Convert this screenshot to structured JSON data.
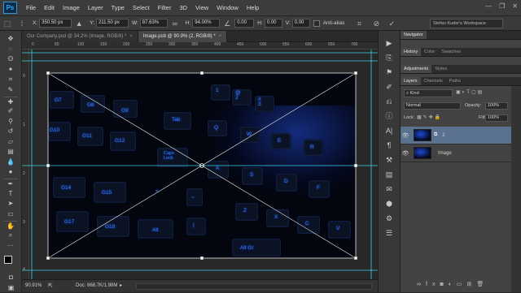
{
  "app": {
    "logo": "Ps"
  },
  "menu": [
    "File",
    "Edit",
    "Image",
    "Layer",
    "Type",
    "Select",
    "Filter",
    "3D",
    "View",
    "Window",
    "Help"
  ],
  "window_controls": [
    "—",
    "❐",
    "✕"
  ],
  "options": {
    "x_label": "X:",
    "x_value": "350.50 px",
    "y_label": "Y:",
    "y_value": "211.50 px",
    "w_label": "W:",
    "w_value": "87.63%",
    "h_label": "H:",
    "h_value": "94.00%",
    "angle_value": "0.00",
    "h_skew_label": "H:",
    "h_skew_value": "0.00",
    "v_skew_label": "V:",
    "v_skew_value": "0.00",
    "antialias_label": "Anti-alias",
    "workspace": "Stefan Kuder's Workspace"
  },
  "tabs": [
    {
      "label": "Our Company.psd @ 34.2% (Image, RGB/8) *",
      "active": false
    },
    {
      "label": "Image.psb @ 90.9% (2, RGB/8) *",
      "active": true
    }
  ],
  "tab_close": "×",
  "ruler_top": [
    "0",
    "50",
    "100",
    "150",
    "200",
    "250",
    "300",
    "350",
    "400",
    "450",
    "500",
    "550",
    "600",
    "650",
    "700"
  ],
  "ruler_left": [
    "0",
    "1",
    "2",
    "3",
    "4"
  ],
  "keys": [
    "G7",
    "G8",
    "G9",
    "1",
    "@\n2",
    "#\n3",
    "G10",
    "G11",
    "G12",
    "Tab",
    "Q",
    "W",
    "E",
    "R",
    "Caps\nLock",
    "A",
    "S",
    "D",
    "F",
    "G14",
    "G15",
    "Z",
    "X",
    "C",
    "V",
    "G17",
    "G18",
    "Alt",
    "Alt Gr",
    "~",
    "|",
    "<"
  ],
  "status": {
    "zoom": "90.91%",
    "doc": "Doc: 868.7K/1.98M"
  },
  "panels": {
    "top_tabs": [
      "Navigator"
    ],
    "color_tabs": [
      "History",
      "Color",
      "Swatches"
    ],
    "adj_tabs": [
      "Adjustments",
      "Styles"
    ],
    "layer_tabs": [
      "Layers",
      "Channels",
      "Paths"
    ],
    "kind": "Kind",
    "blend_mode": "Normal",
    "opacity_label": "Opacity:",
    "opacity_value": "100%",
    "lock_label": "Lock:",
    "fill_label": "Fill:",
    "fill_value": "100%",
    "layers": [
      {
        "name": "2",
        "selected": true
      },
      {
        "name": "Image",
        "selected": false
      }
    ]
  }
}
